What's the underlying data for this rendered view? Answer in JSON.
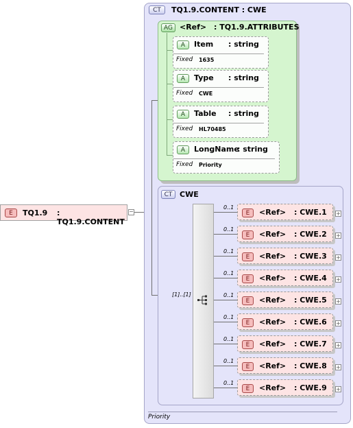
{
  "root_element": {
    "badge": "E",
    "name": "TQ1.9",
    "type": ": TQ1.9.CONTENT"
  },
  "content_type": {
    "badge": "CT",
    "title": "TQ1.9.CONTENT : CWE",
    "footer": "Priority"
  },
  "attribute_group": {
    "badge": "AG",
    "ref": "<Ref>",
    "type": ": TQ1.9.ATTRIBUTES",
    "attributes": [
      {
        "badge": "A",
        "name": "Item",
        "type": ": string",
        "fixed_label": "Fixed",
        "fixed_value": "1635"
      },
      {
        "badge": "A",
        "name": "Type",
        "type": ": string",
        "fixed_label": "Fixed",
        "fixed_value": "CWE"
      },
      {
        "badge": "A",
        "name": "Table",
        "type": ": string",
        "fixed_label": "Fixed",
        "fixed_value": "HL70485"
      },
      {
        "badge": "A",
        "name": "LongName",
        "type": ": string",
        "fixed_label": "Fixed",
        "fixed_value": "Priority"
      }
    ]
  },
  "cwe_type": {
    "badge": "CT",
    "title": "CWE",
    "sequence_occurrence": "[1]..[1]",
    "elements": [
      {
        "occurrence": "0..1",
        "badge": "E",
        "ref": "<Ref>",
        "type": ": CWE.1",
        "expand": "+"
      },
      {
        "occurrence": "0..1",
        "badge": "E",
        "ref": "<Ref>",
        "type": ": CWE.2",
        "expand": "+"
      },
      {
        "occurrence": "0..1",
        "badge": "E",
        "ref": "<Ref>",
        "type": ": CWE.3",
        "expand": "+"
      },
      {
        "occurrence": "0..1",
        "badge": "E",
        "ref": "<Ref>",
        "type": ": CWE.4",
        "expand": "+"
      },
      {
        "occurrence": "0..1",
        "badge": "E",
        "ref": "<Ref>",
        "type": ": CWE.5",
        "expand": "+"
      },
      {
        "occurrence": "0..1",
        "badge": "E",
        "ref": "<Ref>",
        "type": ": CWE.6",
        "expand": "+"
      },
      {
        "occurrence": "0..1",
        "badge": "E",
        "ref": "<Ref>",
        "type": ": CWE.7",
        "expand": "+"
      },
      {
        "occurrence": "0..1",
        "badge": "E",
        "ref": "<Ref>",
        "type": ": CWE.8",
        "expand": "+"
      },
      {
        "occurrence": "0..1",
        "badge": "E",
        "ref": "<Ref>",
        "type": ": CWE.9",
        "expand": "+"
      }
    ]
  },
  "colors": {
    "content_type_bg": "#e4e4fa",
    "attribute_group_bg": "#d5f5cf",
    "element_bg": "#fde4e4",
    "badge_element": "#f6bdbd"
  }
}
